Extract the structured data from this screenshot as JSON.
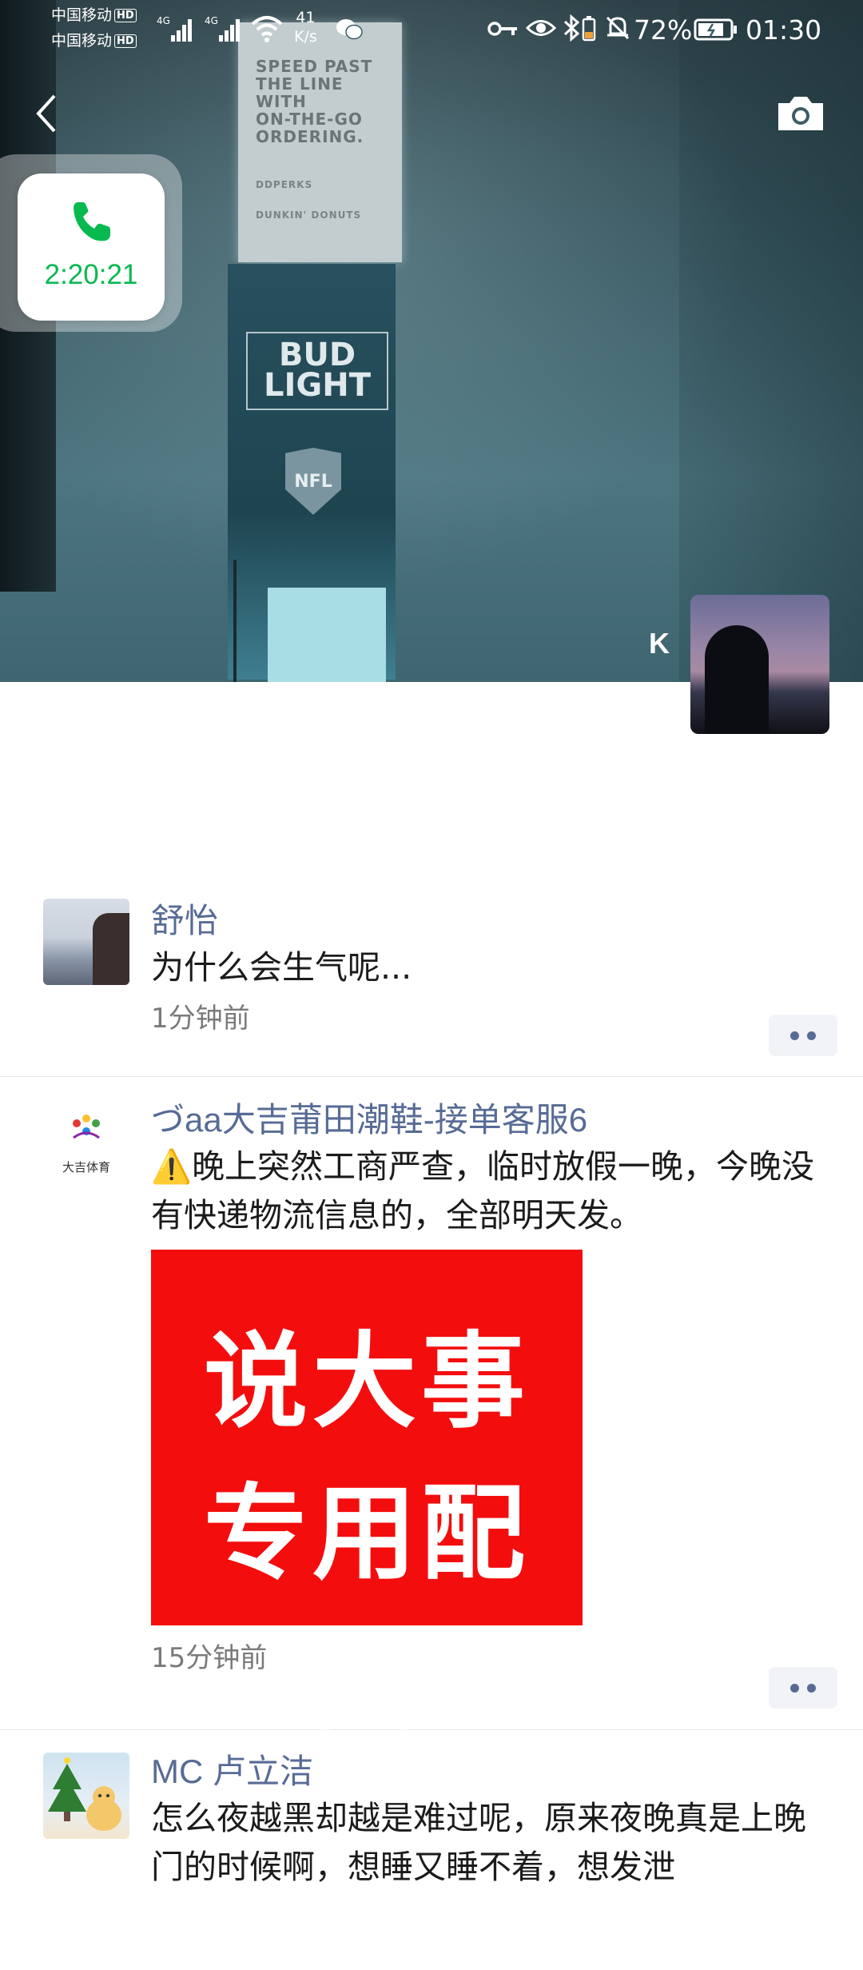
{
  "status_bar": {
    "carrier_1": "中国移动",
    "carrier_2": "中国移动",
    "hd": "HD",
    "net_type": "4G",
    "net_speed_value": "41",
    "net_speed_unit": "K/s",
    "battery": "72%",
    "time": "01:30"
  },
  "cover": {
    "billboard_lines": [
      "SPEED PAST",
      "THE LINE",
      "WITH",
      "ON-THE-GO",
      "ORDERING."
    ],
    "billboard_brand_1": "DDPERKS",
    "billboard_brand_2": "DUNKIN' DONUTS",
    "bud_light": "BUD LIGHT",
    "nfl": "NFL"
  },
  "call": {
    "duration": "2:20:21"
  },
  "profile": {
    "name": "K"
  },
  "posts": [
    {
      "author": "舒怡",
      "text": "为什么会生气呢...",
      "time": "1分钟前"
    },
    {
      "author": "づaa大吉莆田潮鞋-接单客服6",
      "avatar_text": "大吉体育",
      "warning_icon": "⚠️",
      "text": "晚上突然工商严查，临时放假一晚，今晚没有快递物流信息的，全部明天发。",
      "image_line_1": "说大事",
      "image_line_2": "专用配图",
      "time": "15分钟前"
    },
    {
      "author": "MC 卢立洁",
      "text": "怎么夜越黑却越是难过呢，原来夜晚真是上晚门的时候啊，想睡又睡不着，想发泄"
    }
  ],
  "colors": {
    "link": "#576b95",
    "call_green": "#08b94f",
    "image_red": "#f40d0d"
  }
}
